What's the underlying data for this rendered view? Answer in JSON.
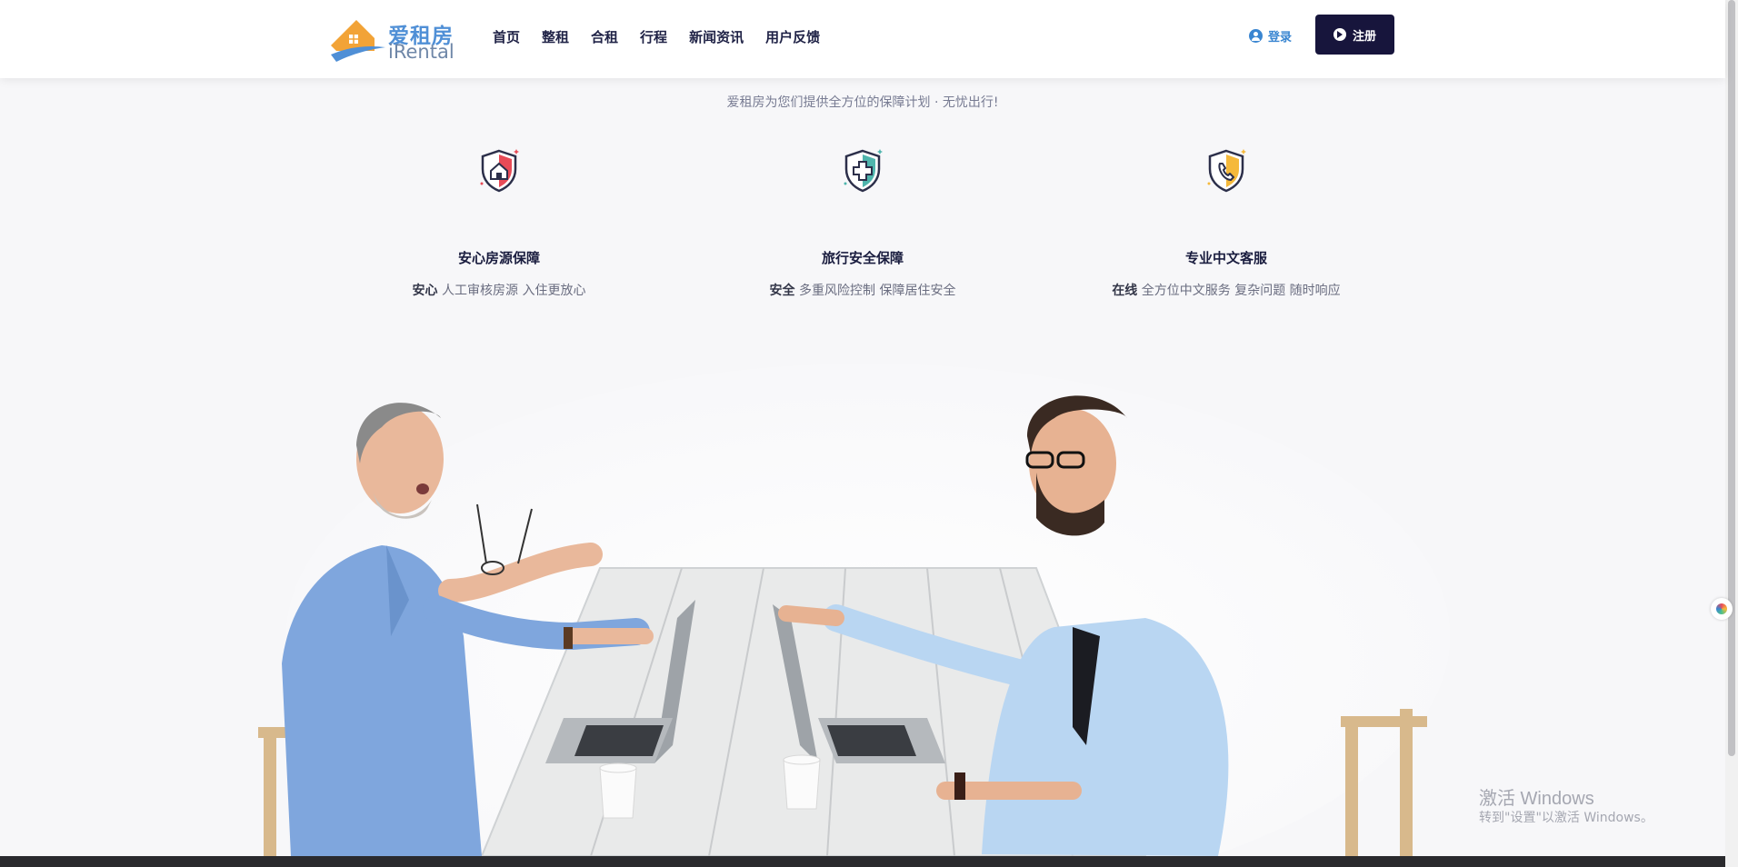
{
  "header": {
    "logo_cn": "爱租房",
    "logo_en": "iRental",
    "nav": [
      "首页",
      "整租",
      "合租",
      "行程",
      "新闻资讯",
      "用户反馈"
    ],
    "login_label": "登录",
    "register_label": "注册"
  },
  "subtitle": "爱租房为您们提供全方位的保障计划 · 无忧出行!",
  "features": [
    {
      "icon": "house-shield-icon",
      "title": "安心房源保障",
      "desc_bold": "安心",
      "desc": " 人工审核房源 入住更放心"
    },
    {
      "icon": "medical-shield-icon",
      "title": "旅行安全保障",
      "desc_bold": "安全",
      "desc": " 多重风险控制 保障居住安全"
    },
    {
      "icon": "phone-shield-icon",
      "title": "专业中文客服",
      "desc_bold": "在线",
      "desc": " 全方位中文服务 复杂问题 随时响应"
    }
  ],
  "watermark": {
    "line1": "激活 Windows",
    "line2": "转到\"设置\"以激活 Windows。"
  },
  "colors": {
    "brand_blue": "#4f8fd6",
    "brand_orange": "#f2a337",
    "register_bg": "#17153c"
  }
}
